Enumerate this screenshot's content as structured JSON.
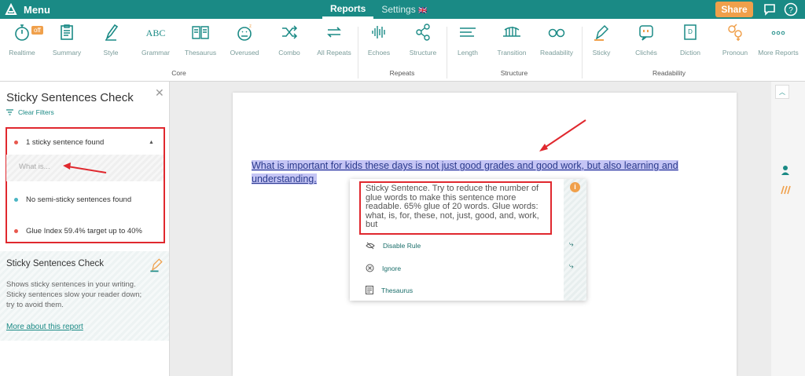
{
  "topbar": {
    "menu_label": "Menu",
    "tabs": [
      {
        "label": "Reports"
      },
      {
        "label": "Settings"
      }
    ],
    "flag": "🇬🇧",
    "share_label": "Share"
  },
  "ribbon": {
    "core": [
      {
        "label": "Realtime",
        "icon": "stopwatch-icon"
      },
      {
        "label": "Summary",
        "icon": "clipboard-icon"
      },
      {
        "label": "Style",
        "icon": "pencil-icon"
      },
      {
        "label": "Grammar",
        "icon": "abc-icon"
      },
      {
        "label": "Thesaurus",
        "icon": "book-icon"
      },
      {
        "label": "Overused",
        "icon": "face-icon"
      },
      {
        "label": "Combo",
        "icon": "shuffle-icon"
      },
      {
        "label": "All Repeats",
        "icon": "repeat-icon"
      }
    ],
    "repeats": [
      {
        "label": "Echoes",
        "icon": "soundwave-icon"
      },
      {
        "label": "Structure",
        "icon": "network-icon"
      }
    ],
    "structure": [
      {
        "label": "Length",
        "icon": "ruler-icon"
      },
      {
        "label": "Transition",
        "icon": "bridge-icon"
      },
      {
        "label": "Readability",
        "icon": "glasses-icon"
      }
    ],
    "readability": [
      {
        "label": "Sticky",
        "icon": "glue-icon"
      },
      {
        "label": "Clichés",
        "icon": "quote-icon"
      },
      {
        "label": "Diction",
        "icon": "dictionary-icon"
      },
      {
        "label": "Pronoun",
        "icon": "gender-icon"
      },
      {
        "label": "More Reports",
        "icon": "dots-icon"
      }
    ],
    "groups": {
      "core": "Core",
      "repeats": "Repeats",
      "structure": "Structure",
      "readability": "Readability"
    },
    "off_badge": "off"
  },
  "sidebar": {
    "title": "Sticky Sentences Check",
    "clear_filters": "Clear Filters",
    "results": [
      {
        "text": "1 sticky sentence found",
        "color": "#e8584e"
      },
      {
        "text": "No semi-sticky sentences found",
        "color": "#4ab5c4"
      },
      {
        "text": "Glue Index 59.4% target up to 40%",
        "color": "#e8584e"
      }
    ],
    "expanded_preview": "What is...",
    "info": {
      "title": "Sticky Sentences Check",
      "body": "Shows sticky sentences in your writing. Sticky sentences slow your reader down; try to avoid them.",
      "link": "More about this report"
    }
  },
  "editor": {
    "highlighted_text": "What is important for kids these days is not just good grades and good work, but also learning and understanding."
  },
  "popup": {
    "message": "Sticky Sentence. Try to reduce the number of glue words to make this sentence more readable. 65% glue of 20 words. Glue words: what, is, for, these, not, just, good, and, work, but",
    "actions": [
      {
        "label": "Disable Rule"
      },
      {
        "label": "Ignore"
      },
      {
        "label": "Thesaurus"
      }
    ]
  }
}
